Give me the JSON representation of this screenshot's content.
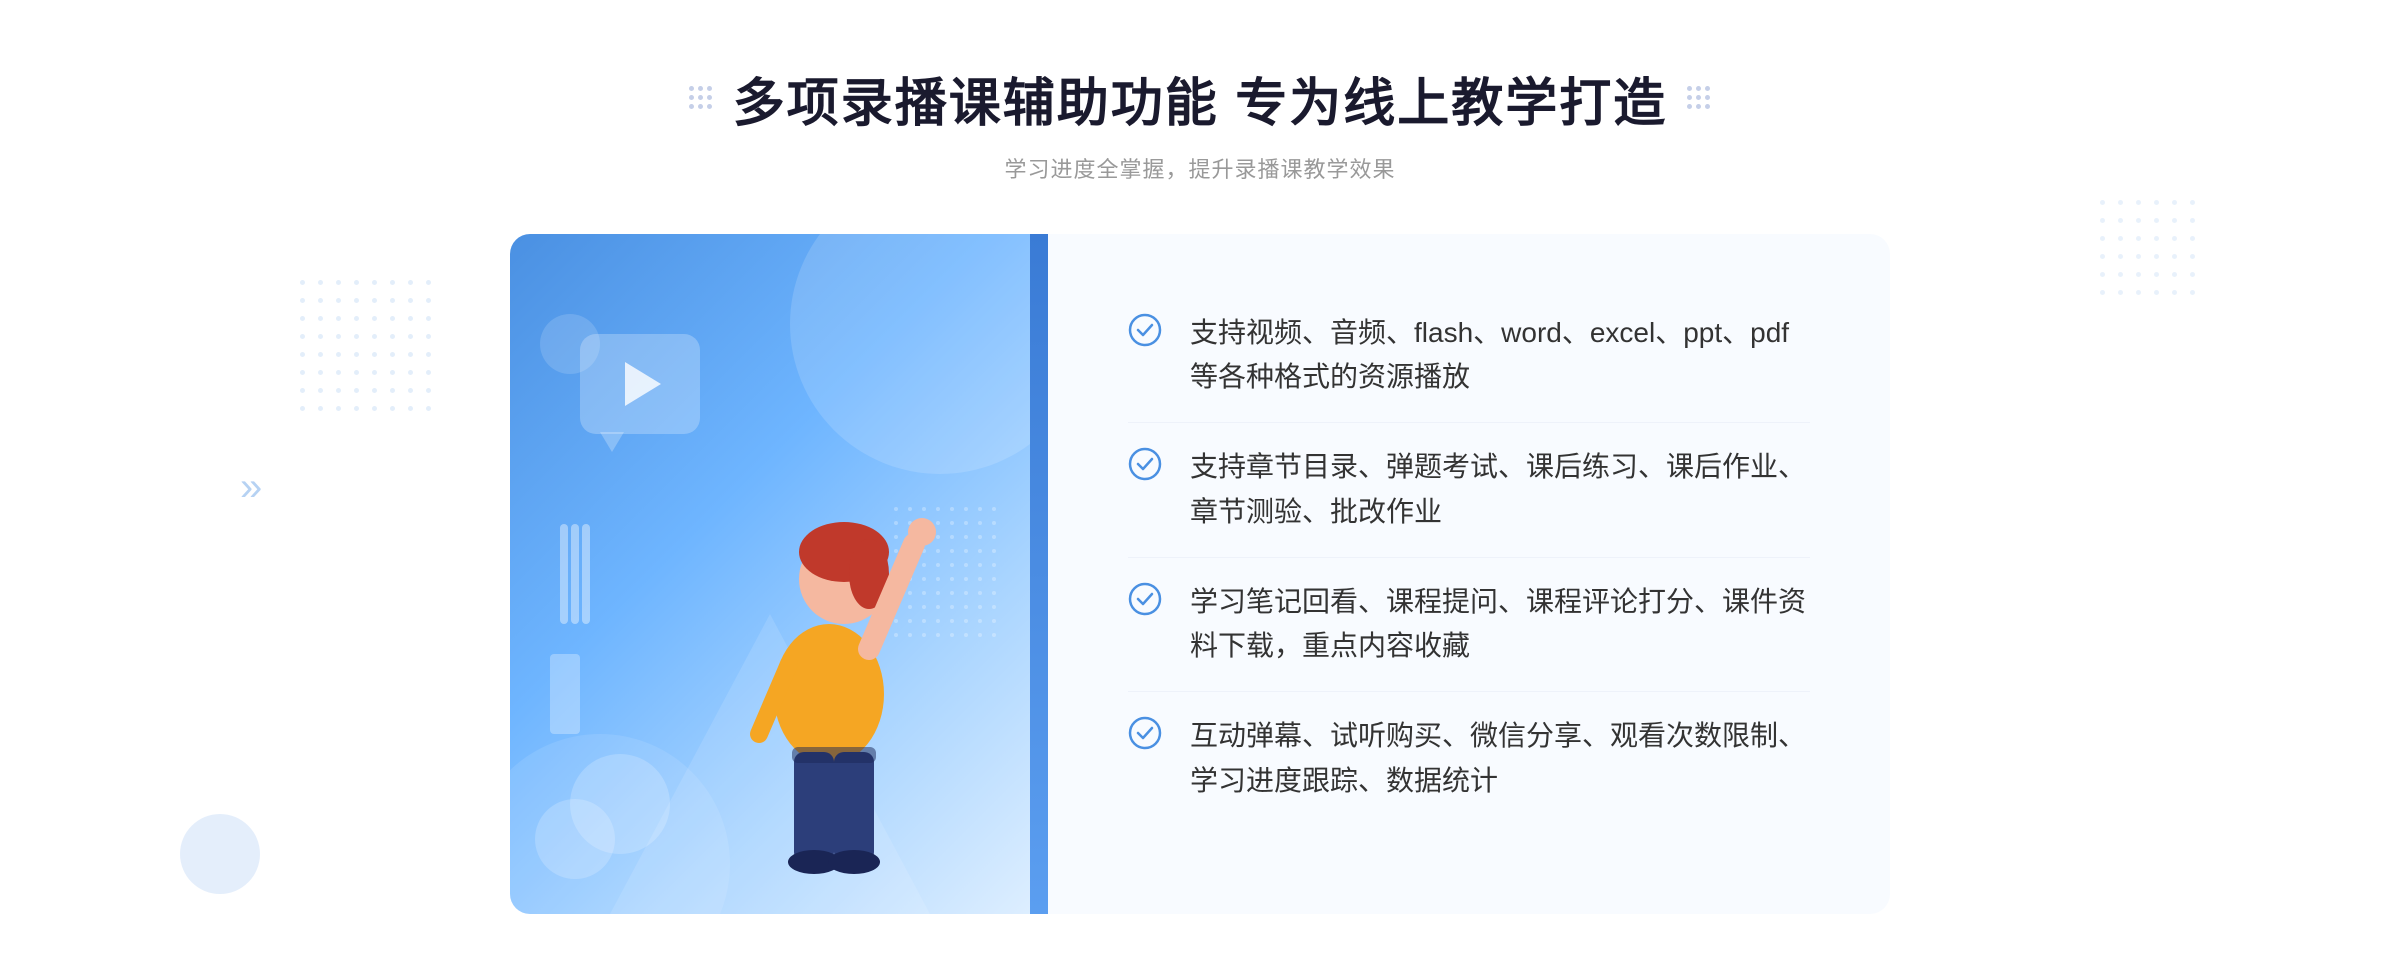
{
  "header": {
    "title": "多项录播课辅助功能 专为线上教学打造",
    "subtitle": "学习进度全掌握，提升录播课教学效果"
  },
  "features": [
    {
      "id": "feature-1",
      "text": "支持视频、音频、flash、word、excel、ppt、pdf等各种格式的资源播放"
    },
    {
      "id": "feature-2",
      "text": "支持章节目录、弹题考试、课后练习、课后作业、章节测验、批改作业"
    },
    {
      "id": "feature-3",
      "text": "学习笔记回看、课程提问、课程评论打分、课件资料下载，重点内容收藏"
    },
    {
      "id": "feature-4",
      "text": "互动弹幕、试听购买、微信分享、观看次数限制、学习进度跟踪、数据统计"
    }
  ],
  "colors": {
    "accent": "#4a90e2",
    "title_color": "#1a1a2e",
    "text_color": "#333333",
    "subtitle_color": "#999999",
    "check_color": "#4a90e2"
  },
  "icons": {
    "check": "circle-check",
    "chevron": "»",
    "play": "▶"
  }
}
